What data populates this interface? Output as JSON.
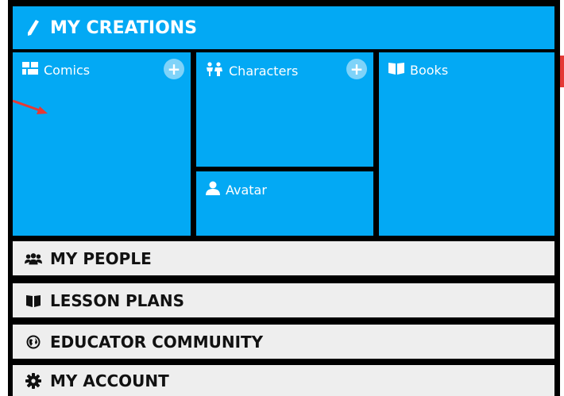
{
  "header": {
    "title": "MY CREATIONS",
    "icon": "pencil-icon"
  },
  "creations": {
    "comics": {
      "label": "Comics",
      "icon": "grid-icon",
      "action": "+"
    },
    "characters": {
      "label": "Characters",
      "icon": "characters-icon",
      "action": "+"
    },
    "avatar": {
      "label": "Avatar",
      "icon": "user-icon"
    },
    "books": {
      "label": "Books",
      "icon": "book-icon"
    }
  },
  "menu": [
    {
      "label": "MY PEOPLE",
      "icon": "people-icon"
    },
    {
      "label": "LESSON PLANS",
      "icon": "open-book-icon"
    },
    {
      "label": "EDUCATOR COMMUNITY",
      "icon": "globe-icon"
    },
    {
      "label": "MY ACCOUNT",
      "icon": "gear-icon"
    }
  ],
  "colors": {
    "accent": "#03a9f4",
    "menu_bg": "#eeeeee",
    "frame": "#000000",
    "arrow": "#e53935"
  }
}
